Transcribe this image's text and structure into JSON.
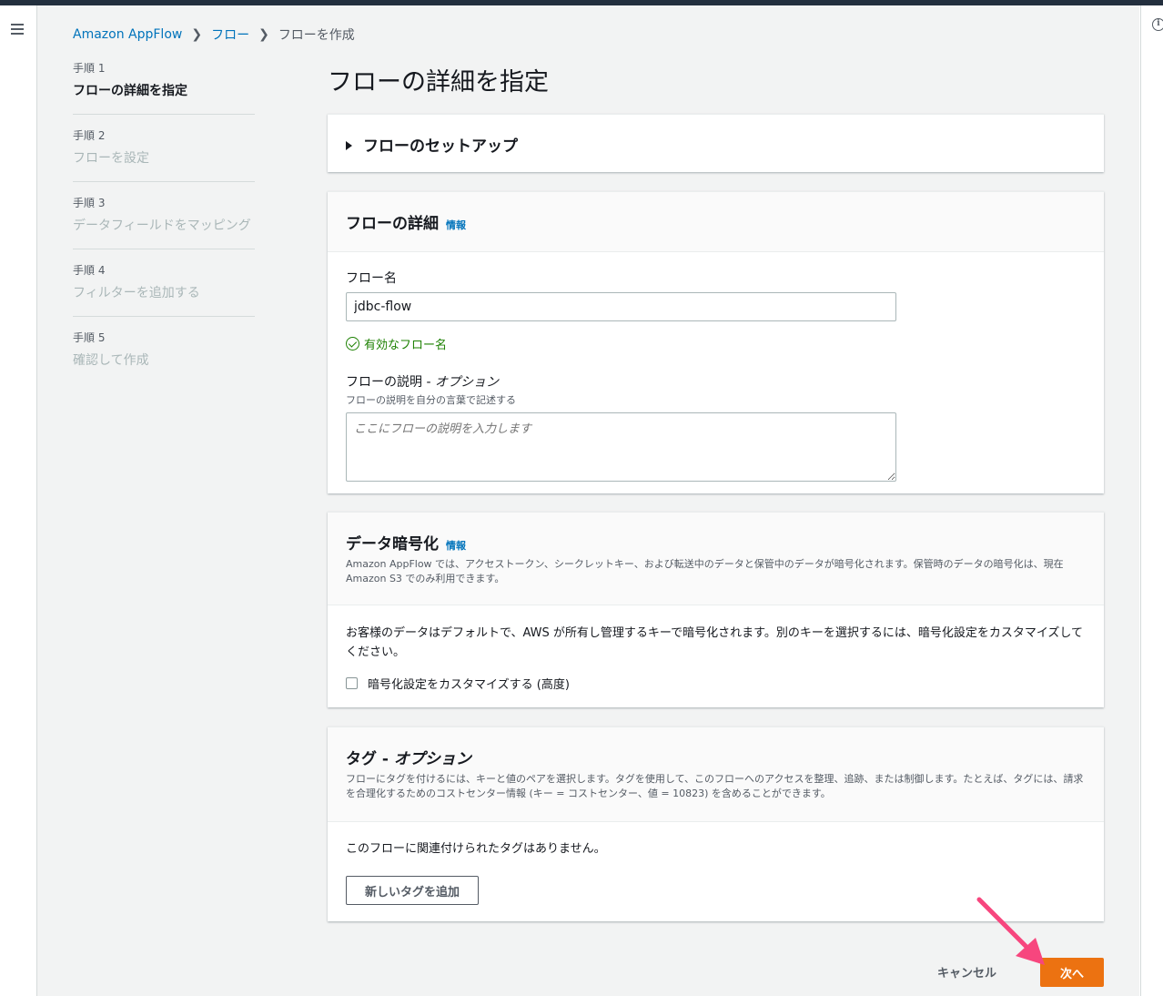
{
  "breadcrumb": {
    "root": "Amazon AppFlow",
    "flows": "フロー",
    "current": "フローを作成"
  },
  "steps": [
    {
      "num": "手順 1",
      "title": "フローの詳細を指定"
    },
    {
      "num": "手順 2",
      "title": "フローを設定"
    },
    {
      "num": "手順 3",
      "title": "データフィールドをマッピング"
    },
    {
      "num": "手順 4",
      "title": "フィルターを追加する"
    },
    {
      "num": "手順 5",
      "title": "確認して作成"
    }
  ],
  "page_title": "フローの詳細を指定",
  "setup": {
    "title": "フローのセットアップ"
  },
  "details": {
    "title": "フローの詳細",
    "info": "情報",
    "name_label": "フロー名",
    "name_value": "jdbc-flow",
    "valid_msg": "有効なフロー名",
    "desc_label": "フローの説明 - ",
    "desc_optional": "オプション",
    "desc_hint": "フローの説明を自分の言葉で記述する",
    "desc_placeholder": "ここにフローの説明を入力します"
  },
  "encryption": {
    "title": "データ暗号化",
    "info": "情報",
    "desc": "Amazon AppFlow では、アクセストークン、シークレットキー、および転送中のデータと保管中のデータが暗号化されます。保管時のデータの暗号化は、現在 Amazon S3 でのみ利用できます。",
    "body": "お客様のデータはデフォルトで、AWS が所有し管理するキーで暗号化されます。別のキーを選択するには、暗号化設定をカスタマイズしてください。",
    "checkbox_label": "暗号化設定をカスタマイズする (高度)"
  },
  "tags": {
    "title": "タグ - ",
    "title_optional": "オプション",
    "desc": "フローにタグを付けるには、キーと値のペアを選択します。タグを使用して、このフローへのアクセスを整理、追跡、または制御します。たとえば、タグには、請求を合理化するためのコストセンター情報 (キー = コストセンター、値 = 10823) を含めることができます。",
    "empty": "このフローに関連付けられたタグはありません。",
    "add_button": "新しいタグを追加"
  },
  "actions": {
    "cancel": "キャンセル",
    "next": "次へ"
  },
  "colors": {
    "primary_button": "#ec7211",
    "link": "#0073bb",
    "success": "#1d8102",
    "annotation_arrow": "#f7467e"
  }
}
